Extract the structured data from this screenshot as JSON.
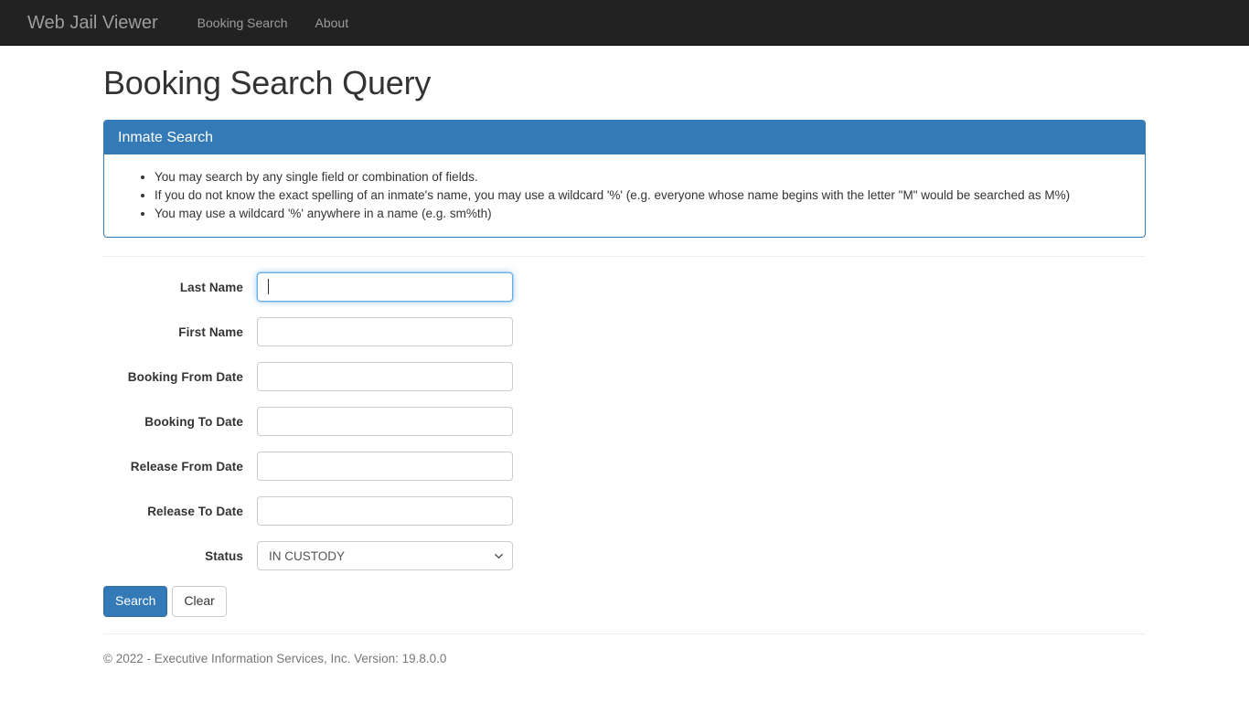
{
  "navbar": {
    "brand": "Web Jail Viewer",
    "links": [
      {
        "label": "Booking Search"
      },
      {
        "label": "About"
      }
    ]
  },
  "page": {
    "title": "Booking Search Query"
  },
  "panel": {
    "heading": "Inmate Search",
    "bullets": [
      "You may search by any single field or combination of fields.",
      "If you do not know the exact spelling of an inmate's name, you may use a wildcard '%' (e.g. everyone whose name begins with the letter \"M\" would be searched as M%)",
      "You may use a wildcard '%' anywhere in a name (e.g. sm%th)"
    ]
  },
  "form": {
    "fields": [
      {
        "label": "Last Name",
        "value": "",
        "placeholder": ""
      },
      {
        "label": "First Name",
        "value": "",
        "placeholder": ""
      },
      {
        "label": "Booking From Date",
        "value": "",
        "placeholder": ""
      },
      {
        "label": "Booking To Date",
        "value": "",
        "placeholder": ""
      },
      {
        "label": "Release From Date",
        "value": "",
        "placeholder": ""
      },
      {
        "label": "Release To Date",
        "value": "",
        "placeholder": ""
      }
    ],
    "status": {
      "label": "Status",
      "selected": "IN CUSTODY",
      "options": [
        "IN CUSTODY"
      ]
    },
    "buttons": {
      "search": "Search",
      "clear": "Clear"
    }
  },
  "footer": {
    "text": "© 2022 - Executive Information Services, Inc. Version: 19.8.0.0"
  },
  "colors": {
    "navbar_bg": "#222222",
    "accent": "#337ab7",
    "focus_ring": "#66afe9",
    "muted_text": "#777777"
  },
  "icons": {
    "chevron_down": "chevron-down-icon"
  }
}
